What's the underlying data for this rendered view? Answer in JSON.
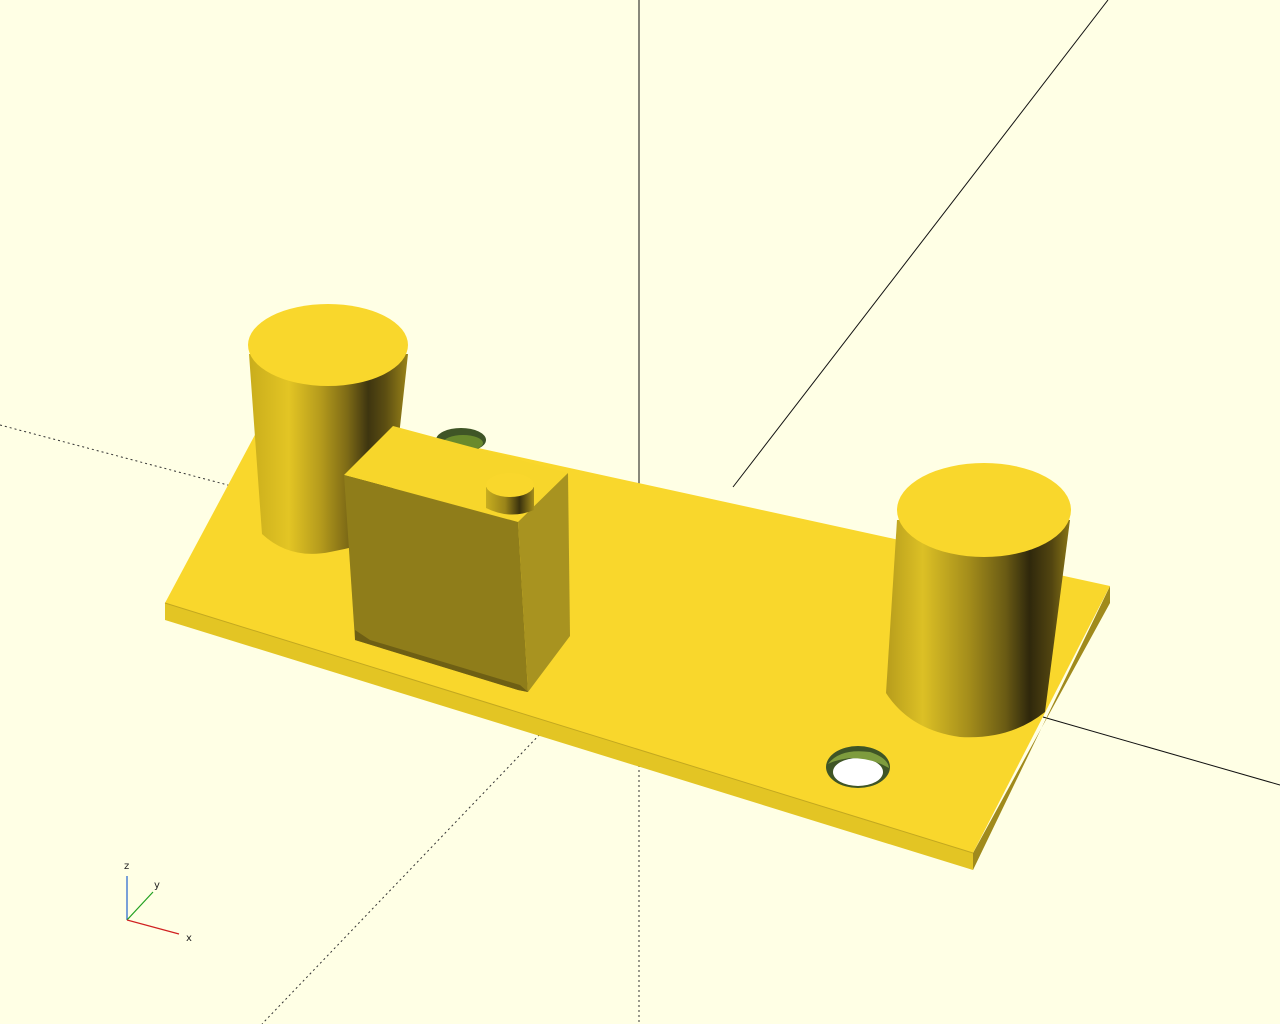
{
  "app": {
    "view": "3d-model-preview"
  },
  "colors": {
    "background": "#ffffe5",
    "model_top": "#f9d72c",
    "model_front": "#e9c722",
    "model_dark": "#8f7d1a",
    "model_side": "#a89320",
    "hole_inner": "#3f5526",
    "axis_x": "#d02020",
    "axis_y": "#20a020",
    "axis_z": "#2060d0"
  },
  "axes_indicator": {
    "x_label": "x",
    "y_label": "y",
    "z_label": "z"
  },
  "model": {
    "parts": [
      "base-plate",
      "left-cylinder",
      "right-cylinder",
      "switch-block",
      "switch-knob",
      "mounting-hole-left",
      "mounting-hole-right"
    ]
  }
}
